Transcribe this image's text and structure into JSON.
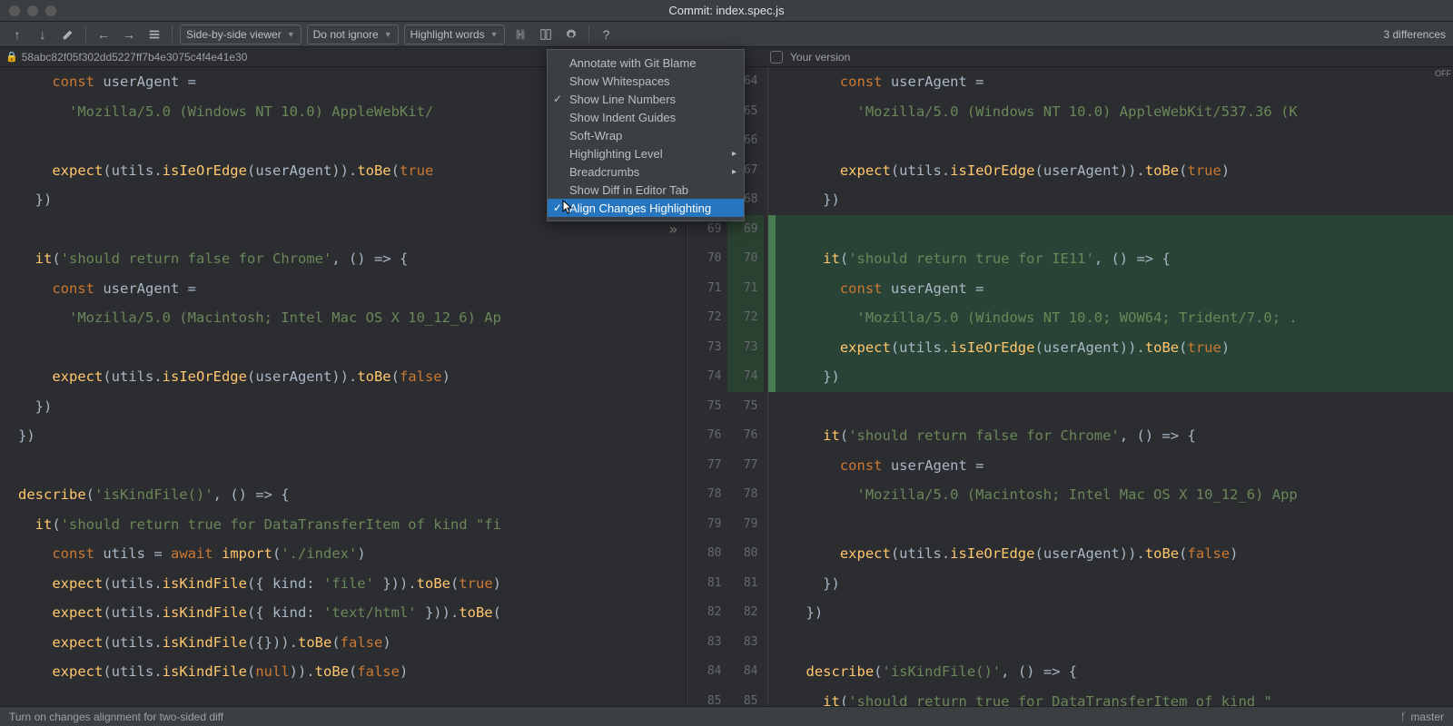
{
  "window": {
    "title": "Commit: index.spec.js"
  },
  "toolbar": {
    "viewer_mode": "Side-by-side viewer",
    "ignore_mode": "Do not ignore",
    "highlight_mode": "Highlight words",
    "diff_count": "3 differences"
  },
  "revision": {
    "left_hash": "58abc82f05f302dd5227ff7b4e3075c4f4e41e30",
    "right_label": "Your version",
    "off_badge": "OFF"
  },
  "context_menu": {
    "items": [
      {
        "label": "Annotate with Git Blame",
        "checked": false,
        "submenu": false
      },
      {
        "label": "Show Whitespaces",
        "checked": false,
        "submenu": false
      },
      {
        "label": "Show Line Numbers",
        "checked": true,
        "submenu": false
      },
      {
        "label": "Show Indent Guides",
        "checked": false,
        "submenu": false
      },
      {
        "label": "Soft-Wrap",
        "checked": false,
        "submenu": false
      },
      {
        "label": "Highlighting Level",
        "checked": false,
        "submenu": true
      },
      {
        "label": "Breadcrumbs",
        "checked": false,
        "submenu": true
      },
      {
        "label": "Show Diff in Editor Tab",
        "checked": false,
        "submenu": false
      },
      {
        "label": "Align Changes Highlighting",
        "checked": true,
        "submenu": false,
        "selected": true
      }
    ]
  },
  "gutter": {
    "rows": [
      {
        "l": "",
        "r": "64"
      },
      {
        "l": "",
        "r": "65"
      },
      {
        "l": "",
        "r": "66"
      },
      {
        "l": "",
        "r": "67"
      },
      {
        "l": "",
        "r": "68"
      },
      {
        "l": "69",
        "r": "69",
        "arrow": true,
        "check": true,
        "hl": true
      },
      {
        "l": "70",
        "r": "70",
        "hl": true
      },
      {
        "l": "71",
        "r": "71",
        "hl": true
      },
      {
        "l": "72",
        "r": "72",
        "hl": true
      },
      {
        "l": "73",
        "r": "73",
        "hl": true
      },
      {
        "l": "74",
        "r": "74",
        "hl": true
      },
      {
        "l": "75",
        "r": "75"
      },
      {
        "l": "76",
        "r": "76"
      },
      {
        "l": "77",
        "r": "77"
      },
      {
        "l": "78",
        "r": "78"
      },
      {
        "l": "79",
        "r": "79"
      },
      {
        "l": "80",
        "r": "80"
      },
      {
        "l": "81",
        "r": "81"
      },
      {
        "l": "82",
        "r": "82"
      },
      {
        "l": "83",
        "r": "83"
      },
      {
        "l": "84",
        "r": "84"
      },
      {
        "l": "85",
        "r": "85"
      }
    ]
  },
  "left_code": [
    [
      [
        "kw",
        "    const "
      ],
      [
        "id",
        "userAgent = "
      ]
    ],
    [
      [
        "str",
        "      'Mozilla/5.0 (Windows NT 10.0) AppleWebKit/"
      ]
    ],
    [
      [
        "",
        ""
      ]
    ],
    [
      [
        "id",
        "    "
      ],
      [
        "call",
        "expect"
      ],
      [
        "punc",
        "(utils."
      ],
      [
        "call",
        "isIeOrEdge"
      ],
      [
        "punc",
        "(userAgent))."
      ],
      [
        "call",
        "toBe"
      ],
      [
        "punc",
        "("
      ],
      [
        "bool",
        "true"
      ]
    ],
    [
      [
        "punc",
        "  })"
      ]
    ],
    [
      [
        "",
        ""
      ]
    ],
    [
      [
        "id",
        "  "
      ],
      [
        "call",
        "it"
      ],
      [
        "punc",
        "("
      ],
      [
        "str",
        "'should return false for Chrome'"
      ],
      [
        "punc",
        ", () => {"
      ]
    ],
    [
      [
        "kw",
        "    const "
      ],
      [
        "id",
        "userAgent = "
      ]
    ],
    [
      [
        "str",
        "      'Mozilla/5.0 (Macintosh; Intel Mac OS X 10_12_6) Ap"
      ]
    ],
    [
      [
        "",
        ""
      ]
    ],
    [
      [
        "id",
        "    "
      ],
      [
        "call",
        "expect"
      ],
      [
        "punc",
        "(utils."
      ],
      [
        "call",
        "isIeOrEdge"
      ],
      [
        "punc",
        "(userAgent))."
      ],
      [
        "call",
        "toBe"
      ],
      [
        "punc",
        "("
      ],
      [
        "bool",
        "false"
      ],
      [
        "punc",
        ")"
      ]
    ],
    [
      [
        "punc",
        "  })"
      ]
    ],
    [
      [
        "punc",
        "})"
      ]
    ],
    [
      [
        "",
        ""
      ]
    ],
    [
      [
        "call",
        "describe"
      ],
      [
        "punc",
        "("
      ],
      [
        "str",
        "'isKindFile()'"
      ],
      [
        "punc",
        ", () => {"
      ]
    ],
    [
      [
        "id",
        "  "
      ],
      [
        "call",
        "it"
      ],
      [
        "punc",
        "("
      ],
      [
        "str",
        "'should return true for DataTransferItem of kind \"fi"
      ]
    ],
    [
      [
        "kw",
        "    const "
      ],
      [
        "id",
        "utils = "
      ],
      [
        "kw",
        "await "
      ],
      [
        "call",
        "import"
      ],
      [
        "punc",
        "("
      ],
      [
        "str",
        "'./index'"
      ],
      [
        "punc",
        ")"
      ]
    ],
    [
      [
        "id",
        "    "
      ],
      [
        "call",
        "expect"
      ],
      [
        "punc",
        "(utils."
      ],
      [
        "call",
        "isKindFile"
      ],
      [
        "punc",
        "({ kind: "
      ],
      [
        "str",
        "'file'"
      ],
      [
        "punc",
        " }))."
      ],
      [
        "call",
        "toBe"
      ],
      [
        "punc",
        "("
      ],
      [
        "bool",
        "true"
      ],
      [
        "punc",
        ")"
      ]
    ],
    [
      [
        "id",
        "    "
      ],
      [
        "call",
        "expect"
      ],
      [
        "punc",
        "(utils."
      ],
      [
        "call",
        "isKindFile"
      ],
      [
        "punc",
        "({ kind: "
      ],
      [
        "str",
        "'text/html'"
      ],
      [
        "punc",
        " }))."
      ],
      [
        "call",
        "toBe"
      ],
      [
        "punc",
        "("
      ]
    ],
    [
      [
        "id",
        "    "
      ],
      [
        "call",
        "expect"
      ],
      [
        "punc",
        "(utils."
      ],
      [
        "call",
        "isKindFile"
      ],
      [
        "punc",
        "({}))."
      ],
      [
        "call",
        "toBe"
      ],
      [
        "punc",
        "("
      ],
      [
        "bool",
        "false"
      ],
      [
        "punc",
        ")"
      ]
    ],
    [
      [
        "id",
        "    "
      ],
      [
        "call",
        "expect"
      ],
      [
        "punc",
        "(utils."
      ],
      [
        "call",
        "isKindFile"
      ],
      [
        "punc",
        "("
      ],
      [
        "bool",
        "null"
      ],
      [
        "punc",
        "))."
      ],
      [
        "call",
        "toBe"
      ],
      [
        "punc",
        "("
      ],
      [
        "bool",
        "false"
      ],
      [
        "punc",
        ")"
      ]
    ]
  ],
  "right_code": [
    [
      [
        "kw",
        "    const "
      ],
      [
        "id",
        "userAgent = "
      ]
    ],
    [
      [
        "str",
        "      'Mozilla/5.0 (Windows NT 10.0) AppleWebKit/537.36 (K"
      ]
    ],
    [
      [
        "",
        ""
      ]
    ],
    [
      [
        "id",
        "    "
      ],
      [
        "call",
        "expect"
      ],
      [
        "punc",
        "(utils."
      ],
      [
        "call",
        "isIeOrEdge"
      ],
      [
        "punc",
        "(userAgent))."
      ],
      [
        "call",
        "toBe"
      ],
      [
        "punc",
        "("
      ],
      [
        "bool",
        "true"
      ],
      [
        "punc",
        ")"
      ]
    ],
    [
      [
        "punc",
        "  })"
      ]
    ],
    [
      [
        "",
        ""
      ]
    ],
    [
      [
        "id",
        "  "
      ],
      [
        "call",
        "it"
      ],
      [
        "punc",
        "("
      ],
      [
        "str",
        "'should return true for IE11'"
      ],
      [
        "punc",
        ", () => {"
      ]
    ],
    [
      [
        "kw",
        "    const "
      ],
      [
        "id",
        "userAgent = "
      ]
    ],
    [
      [
        "str",
        "      'Mozilla/5.0 (Windows NT 10.0; WOW64; Trident/7.0; ."
      ]
    ],
    [
      [
        "id",
        "    "
      ],
      [
        "call",
        "expect"
      ],
      [
        "punc",
        "(utils."
      ],
      [
        "call",
        "isIeOrEdge"
      ],
      [
        "punc",
        "(userAgent))."
      ],
      [
        "call",
        "toBe"
      ],
      [
        "punc",
        "("
      ],
      [
        "bool",
        "true"
      ],
      [
        "punc",
        ")"
      ]
    ],
    [
      [
        "punc",
        "  })"
      ]
    ],
    [
      [
        "",
        ""
      ]
    ],
    [
      [
        "id",
        "  "
      ],
      [
        "call",
        "it"
      ],
      [
        "punc",
        "("
      ],
      [
        "str",
        "'should return false for Chrome'"
      ],
      [
        "punc",
        ", () => {"
      ]
    ],
    [
      [
        "kw",
        "    const "
      ],
      [
        "id",
        "userAgent = "
      ]
    ],
    [
      [
        "str",
        "      'Mozilla/5.0 (Macintosh; Intel Mac OS X 10_12_6) App"
      ]
    ],
    [
      [
        "",
        ""
      ]
    ],
    [
      [
        "id",
        "    "
      ],
      [
        "call",
        "expect"
      ],
      [
        "punc",
        "(utils."
      ],
      [
        "call",
        "isIeOrEdge"
      ],
      [
        "punc",
        "(userAgent))."
      ],
      [
        "call",
        "toBe"
      ],
      [
        "punc",
        "("
      ],
      [
        "bool",
        "false"
      ],
      [
        "punc",
        ")"
      ]
    ],
    [
      [
        "punc",
        "  })"
      ]
    ],
    [
      [
        "punc",
        "})"
      ]
    ],
    [
      [
        "",
        ""
      ]
    ],
    [
      [
        "call",
        "describe"
      ],
      [
        "punc",
        "("
      ],
      [
        "str",
        "'isKindFile()'"
      ],
      [
        "punc",
        ", () => {"
      ]
    ],
    [
      [
        "id",
        "  "
      ],
      [
        "call",
        "it"
      ],
      [
        "punc",
        "("
      ],
      [
        "str",
        "'should return true for DataTransferItem of kind \""
      ]
    ]
  ],
  "right_highlight": {
    "start": 5,
    "end": 11
  },
  "statusbar": {
    "hint": "Turn on changes alignment for two-sided diff",
    "branch": "master"
  }
}
